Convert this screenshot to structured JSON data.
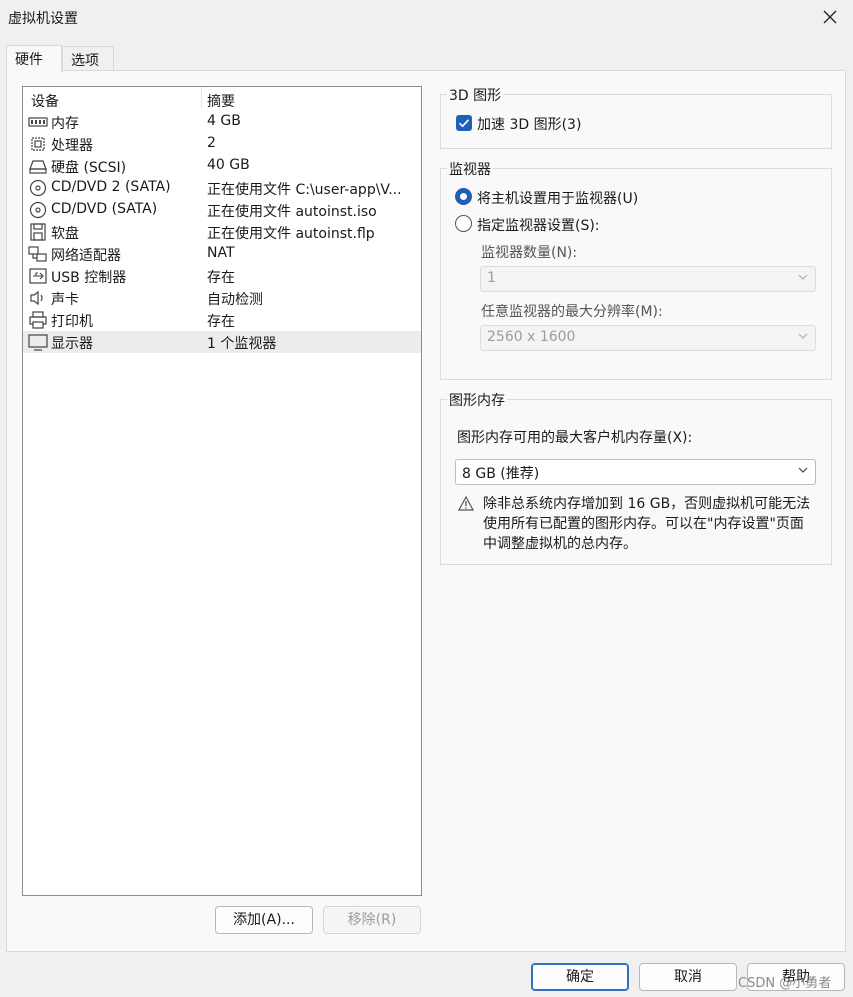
{
  "window": {
    "title": "虚拟机设置"
  },
  "tabs": [
    {
      "label": "硬件"
    },
    {
      "label": "选项"
    }
  ],
  "device_list": {
    "columns": {
      "device": "设备",
      "summary": "摘要"
    },
    "items": [
      {
        "name": "内存",
        "summary": "4 GB",
        "icon": "memory-icon"
      },
      {
        "name": "处理器",
        "summary": "2",
        "icon": "processor-icon"
      },
      {
        "name": "硬盘 (SCSI)",
        "summary": "40 GB",
        "icon": "hard-disk-icon"
      },
      {
        "name": "CD/DVD 2 (SATA)",
        "summary": "正在使用文件 C:\\user-app\\V...",
        "icon": "cd-dvd-icon"
      },
      {
        "name": "CD/DVD (SATA)",
        "summary": "正在使用文件 autoinst.iso",
        "icon": "cd-dvd-icon"
      },
      {
        "name": "软盘",
        "summary": "正在使用文件 autoinst.flp",
        "icon": "floppy-icon"
      },
      {
        "name": "网络适配器",
        "summary": "NAT",
        "icon": "network-adapter-icon"
      },
      {
        "name": "USB 控制器",
        "summary": "存在",
        "icon": "usb-icon"
      },
      {
        "name": "声卡",
        "summary": "自动检测",
        "icon": "speaker-icon"
      },
      {
        "name": "打印机",
        "summary": "存在",
        "icon": "printer-icon"
      },
      {
        "name": "显示器",
        "summary": "1 个监视器",
        "icon": "monitor-icon",
        "selected": true
      }
    ],
    "add_button": "添加(A)...",
    "remove_button": "移除(R)"
  },
  "graphics_3d": {
    "legend": "3D 图形",
    "accelerate_label": "加速 3D 图形(3)",
    "accelerate_checked": true
  },
  "monitor": {
    "legend": "监视器",
    "use_host_label": "将主机设置用于监视器(U)",
    "specify_label": "指定监视器设置(S):",
    "selected_option": "use_host",
    "count_label": "监视器数量(N):",
    "count_value": "1",
    "max_res_label": "任意监视器的最大分辨率(M):",
    "max_res_value": "2560 x 1600"
  },
  "graphics_memory": {
    "legend": "图形内存",
    "max_label": "图形内存可用的最大客户机内存量(X):",
    "value": "8 GB (推荐)",
    "warning": "除非总系统内存增加到 16 GB，否则虚拟机可能无法使用所有已配置的图形内存。可以在\"内存设置\"页面中调整虚拟机的总内存。"
  },
  "footer": {
    "ok": "确定",
    "cancel": "取消",
    "help": "帮助"
  },
  "watermark": "CSDN @小勇者",
  "colors": {
    "accent": "#1f5fb5",
    "selected_row": "#ececec"
  }
}
